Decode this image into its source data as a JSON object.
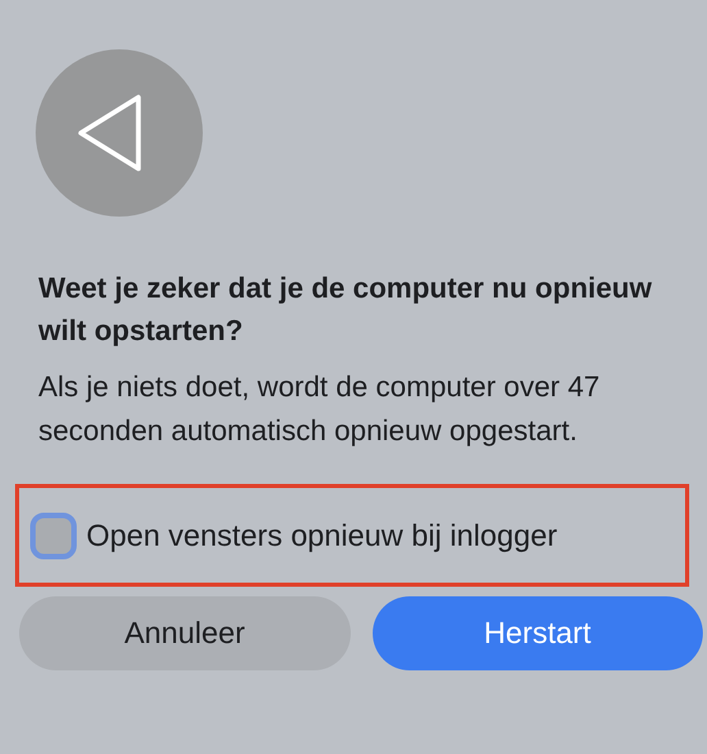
{
  "dialog": {
    "title": "Weet je zeker dat je de computer nu opnieuw wilt opstarten?",
    "message": "Als je niets doet, wordt de computer over 47 seconden automatisch opnieuw opgestart.",
    "option": {
      "label": "Open vensters opnieuw bij inlogger",
      "checked": false,
      "focused": true,
      "highlighted": true
    },
    "buttons": [
      {
        "label": "Annuleer",
        "kind": "secondary"
      },
      {
        "label": "Herstart",
        "kind": "primary"
      }
    ]
  }
}
